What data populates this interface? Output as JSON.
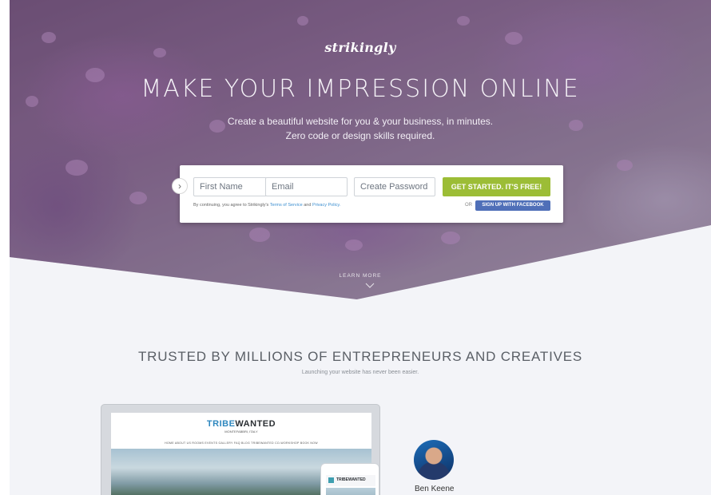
{
  "brand": {
    "logo": "strikingly"
  },
  "hero": {
    "headline": "MAKE YOUR IMPRESSION ONLINE",
    "subline_1": "Create a beautiful website for you & your business, in minutes.",
    "subline_2": "Zero code or design skills required.",
    "learn_more": "LEARN MORE"
  },
  "signup": {
    "first_name_placeholder": "First Name",
    "email_placeholder": "Email",
    "password_placeholder": "Create Password",
    "cta_label": "GET STARTED. IT'S FREE!",
    "terms_prefix": "By continuing, you agree to Strikingly's",
    "terms_link": "Terms of Service",
    "terms_and": "and",
    "privacy_link": "Privacy Policy.",
    "or_label": "OR",
    "facebook_label": "SIGN UP WITH FACEBOOK"
  },
  "trusted": {
    "heading": "TRUSTED BY MILLIONS OF ENTREPRENEURS AND CREATIVES",
    "subheading": "Launching your website has never been easier."
  },
  "showcase": {
    "site_logo_a": "TRIBE",
    "site_logo_b": "WANTED",
    "site_tagline": "MONTEFABBRI, ITALY",
    "site_nav": "HOME   ABOUT US   ROOMS   EVENTS   GALLERY   FAQ   BLOG   TRIBEWANTED   CO-WORKSHOP   BOOK NOW",
    "mobile_logo": "TRIBEWANTED"
  },
  "testimonial": {
    "name": "Ben Keene"
  },
  "colors": {
    "cta": "#9cbd36",
    "facebook": "#4f6fb8",
    "link": "#3c8fd0"
  }
}
